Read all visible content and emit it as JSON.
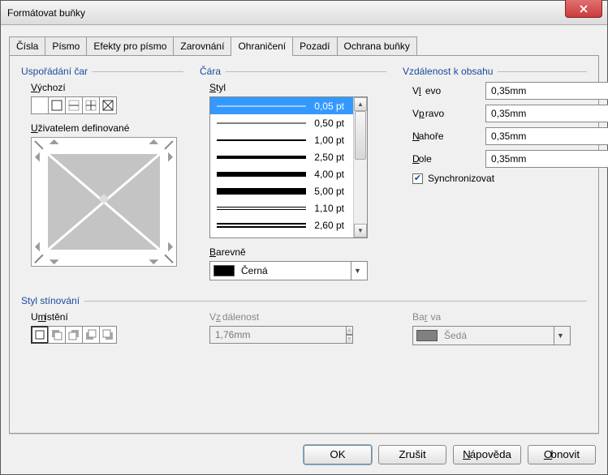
{
  "window": {
    "title": "Formátovat buňky"
  },
  "tabs": [
    "Čísla",
    "Písmo",
    "Efekty pro písmo",
    "Zarovnání",
    "Ohraničení",
    "Pozadí",
    "Ochrana buňky"
  ],
  "active_tab": 4,
  "groups": {
    "arrangement": "Uspořádání čar",
    "line": "Čára",
    "padding": "Vzdálenost k obsahu",
    "shadow": "Styl stínování"
  },
  "arrangement": {
    "default_label": "Výchozí",
    "userdef_label": "Uživatelem definované"
  },
  "line": {
    "style_label": "Styl",
    "styles": [
      {
        "label": "0,05 pt",
        "h": 1,
        "selected": true
      },
      {
        "label": "0,50 pt",
        "h": 1
      },
      {
        "label": "1,00 pt",
        "h": 2
      },
      {
        "label": "2,50 pt",
        "h": 4
      },
      {
        "label": "4,00 pt",
        "h": 6
      },
      {
        "label": "5,00 pt",
        "h": 8
      },
      {
        "label": "1,10 pt",
        "h": 1,
        "double": true
      },
      {
        "label": "2,60 pt",
        "h": 2,
        "double": true
      }
    ],
    "color_label": "Barevně",
    "color_name": "Černá",
    "color_hex": "#000000"
  },
  "padding": {
    "left": {
      "label": "Vlevo",
      "value": "0,35mm"
    },
    "right": {
      "label": "Vpravo",
      "value": "0,35mm"
    },
    "top": {
      "label": "Nahoře",
      "value": "0,35mm"
    },
    "bottom": {
      "label": "Dole",
      "value": "0,35mm"
    },
    "sync_label": "Synchronizovat",
    "sync_checked": true
  },
  "shadow": {
    "position_label": "Umístění",
    "distance_label": "Vzdálenost",
    "distance_value": "1,76mm",
    "color_label": "Barva",
    "color_name": "Šedá",
    "color_hex": "#808080"
  },
  "buttons": {
    "ok": "OK",
    "cancel": "Zrušit",
    "help": "Nápověda",
    "reset": "Obnovit"
  }
}
